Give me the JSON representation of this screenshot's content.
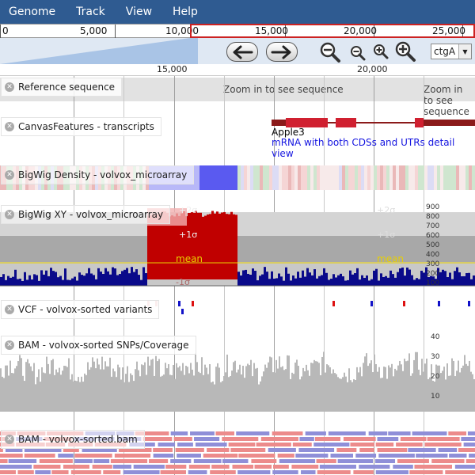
{
  "menu": {
    "items": [
      "Genome",
      "Track",
      "View",
      "Help"
    ]
  },
  "overview": {
    "ticks": [
      "0",
      "5,000",
      "10,000",
      "15,000",
      "20,000",
      "25,000"
    ]
  },
  "navigation": {
    "ref_select": "ctgA"
  },
  "detail_ruler": {
    "ticks": [
      "15,000",
      "20,000"
    ]
  },
  "tracks": {
    "reference": {
      "label": "Reference sequence",
      "zoom_message": "Zoom in to see sequence"
    },
    "features": {
      "label": "CanvasFeatures - transcripts",
      "feature_name": "Apple3",
      "feature_description": "mRNA with both CDSs and UTRs detail view"
    },
    "density": {
      "label": "BigWig Density - volvox_microarray"
    },
    "xy": {
      "label": "BigWig XY - volvox_microarray",
      "axis_ticks": [
        "900",
        "800",
        "700",
        "600",
        "500",
        "400",
        "300",
        "200",
        "100"
      ],
      "plus2": "+2σ",
      "plus1": "+1σ",
      "mean": "mean",
      "minus": "-1σ"
    },
    "vcf": {
      "label": "VCF - volvox-sorted variants"
    },
    "coverage": {
      "label": "BAM - volvox-sorted SNPs/Coverage",
      "axis_ticks": [
        "40",
        "30",
        "20",
        "10"
      ]
    },
    "bam": {
      "label": "BAM - volvox-sorted.bam"
    }
  },
  "colors": {
    "menu_bg": "#2f5b91",
    "feature_red": "#d02030",
    "feature_intron": "#8b1a1a",
    "xy_bar": "#0a0a8a",
    "xy_red": "#c00000",
    "coverage": "#b8b8b8",
    "bam_forward": "#ec8b8b",
    "bam_reverse": "#8f8fd8"
  }
}
